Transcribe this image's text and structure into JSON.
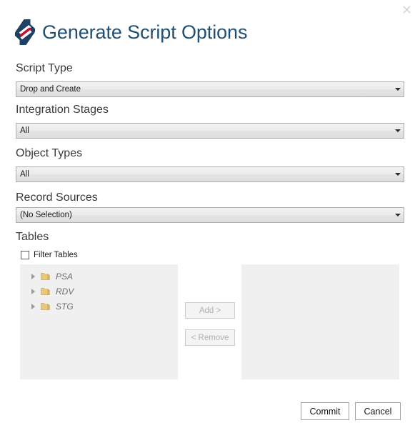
{
  "window": {
    "title": "Generate Script Options",
    "close_label": "×",
    "logo_name": "data-vault-logo",
    "logo_colors": {
      "primary": "#1f3f63",
      "accent": "#c8102e"
    },
    "accent_color": "#215073"
  },
  "form": {
    "fields": [
      {
        "label": "Script Type",
        "value": "Drop and Create",
        "name": "script-type"
      },
      {
        "label": "Integration Stages",
        "value": "All",
        "name": "integration-stages"
      },
      {
        "label": "Object Types",
        "value": "All",
        "name": "object-types"
      },
      {
        "label": "Record Sources",
        "value": "(No Selection)",
        "name": "record-sources"
      }
    ]
  },
  "tables": {
    "heading": "Tables",
    "filter_checkbox": {
      "label": "Filter Tables",
      "checked": false
    },
    "available": [
      {
        "label": "PSA",
        "expanded": false
      },
      {
        "label": "RDV",
        "expanded": false
      },
      {
        "label": "STG",
        "expanded": false
      }
    ],
    "selected": [],
    "transfer": {
      "add_label": "Add >",
      "remove_label": "< Remove",
      "add_enabled": false,
      "remove_enabled": false
    }
  },
  "footer": {
    "commit_label": "Commit",
    "cancel_label": "Cancel"
  }
}
